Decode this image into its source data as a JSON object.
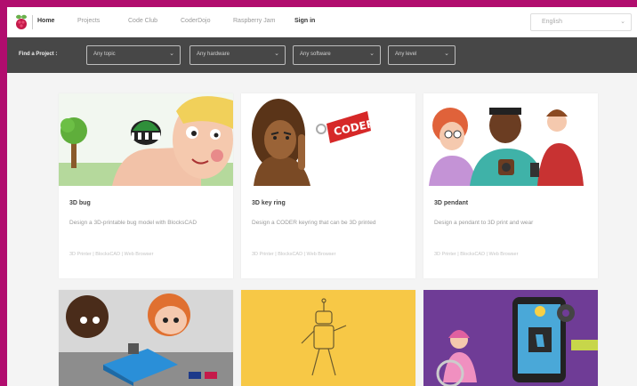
{
  "nav": {
    "links": [
      "Home",
      "Projects",
      "Code Club",
      "CoderDojo",
      "Raspberry Jam",
      "Sign in"
    ],
    "language": "English"
  },
  "filters": {
    "label": "Find a Project :",
    "selects": [
      "Any topic",
      "Any hardware",
      "Any software",
      "Any level"
    ]
  },
  "projects": [
    {
      "title": "3D bug",
      "description": "Design a 3D-printable bug model with BlocksCAD",
      "meta": "3D Printer | BlocksCAD | Web Browser"
    },
    {
      "title": "3D key ring",
      "description": "Design a CODER keyring that can be 3D printed",
      "meta": "3D Printer | BlocksCAD | Web Browser"
    },
    {
      "title": "3D pendant",
      "description": "Design a pendant to 3D print and wear",
      "meta": "3D Printer | BlocksCAD | Web Browser"
    }
  ],
  "colors": {
    "border": "#b10d6e",
    "filterbar": "#474747",
    "card4_bg": "#d7d7d7",
    "card5_bg": "#f7c846",
    "card6_bg": "#6f3c96"
  }
}
